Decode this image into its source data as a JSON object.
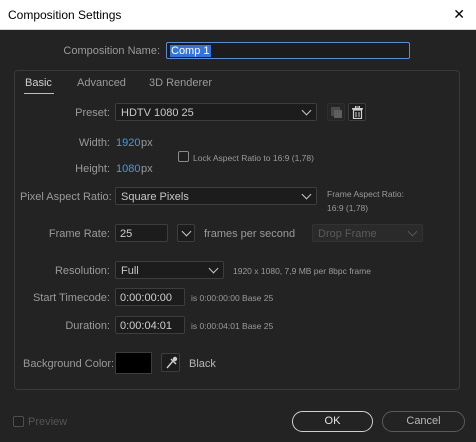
{
  "window": {
    "title": "Composition Settings",
    "close_glyph": "✕"
  },
  "composition_name": {
    "label": "Composition Name:",
    "value": "Comp 1"
  },
  "tabs": [
    {
      "label": "Basic",
      "active": true
    },
    {
      "label": "Advanced",
      "active": false
    },
    {
      "label": "3D Renderer",
      "active": false
    }
  ],
  "preset": {
    "label": "Preset:",
    "value": "HDTV 1080 25",
    "icons": [
      "save-preset-icon",
      "trash-icon"
    ]
  },
  "width": {
    "label": "Width:",
    "value": "1920",
    "unit": "px"
  },
  "height": {
    "label": "Height:",
    "value": "1080",
    "unit": "px"
  },
  "lock_aspect": {
    "label": "Lock Aspect Ratio to 16:9 (1,78)",
    "checked": false
  },
  "pixel_aspect": {
    "label": "Pixel Aspect Ratio:",
    "value": "Square Pixels"
  },
  "frame_aspect": {
    "label": "Frame Aspect Ratio:",
    "value": "16:9 (1,78)"
  },
  "frame_rate": {
    "label": "Frame Rate:",
    "value": "25",
    "unit": "frames per second",
    "drop_frame": "Drop Frame"
  },
  "resolution": {
    "label": "Resolution:",
    "value": "Full",
    "info": "1920 x 1080, 7,9 MB per 8bpc frame"
  },
  "start_timecode": {
    "label": "Start Timecode:",
    "value": "0:00:00:00",
    "info": "is 0:00:00:00  Base 25"
  },
  "duration": {
    "label": "Duration:",
    "value": "0:00:04:01",
    "info": "is 0:00:04:01  Base 25"
  },
  "background_color": {
    "label": "Background Color:",
    "swatch": "#000000",
    "name": "Black",
    "icon": "eyedropper-icon"
  },
  "footer": {
    "preview_label": "Preview",
    "ok_label": "OK",
    "cancel_label": "Cancel"
  },
  "colors": {
    "accent_blue": "#3f9bea",
    "selection": "#3874d8",
    "background": "#232323"
  }
}
